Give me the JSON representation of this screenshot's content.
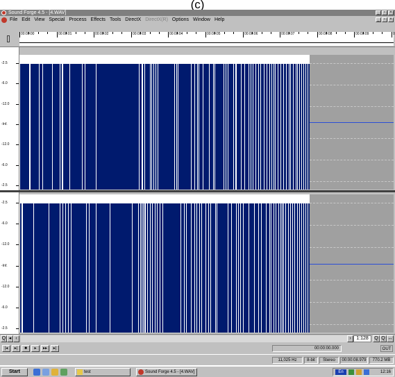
{
  "caption": "(c)",
  "window": {
    "title": "Sound Forge 4.5 - [4.WAV]"
  },
  "menu": [
    {
      "label": "File",
      "enabled": true
    },
    {
      "label": "Edit",
      "enabled": true
    },
    {
      "label": "View",
      "enabled": true
    },
    {
      "label": "Special",
      "enabled": true
    },
    {
      "label": "Process",
      "enabled": true
    },
    {
      "label": "Effects",
      "enabled": true
    },
    {
      "label": "Tools",
      "enabled": true
    },
    {
      "label": "DirectX",
      "enabled": true
    },
    {
      "label": "DirectX(R)",
      "enabled": false
    },
    {
      "label": "Options",
      "enabled": true
    },
    {
      "label": "Window",
      "enabled": true
    },
    {
      "label": "Help",
      "enabled": true
    }
  ],
  "ruler": {
    "labels": [
      "00:00:00",
      "00:00:01",
      "00:00:02",
      "00:00:03",
      "00:00:04",
      "00:00:05",
      "00:00:06",
      "00:00:07",
      "00:00:08",
      "00:00:09",
      "00:00:10"
    ]
  },
  "scale_labels": {
    "left": [
      "-2.5",
      "-6.0",
      "-12.0",
      "-Inf.",
      "-12.0",
      "-6.0",
      "-2.5"
    ],
    "right": [
      "-2.5",
      "-6.0",
      "-12.0",
      "-Inf.",
      "-12.0",
      "-6.0",
      "-2.5"
    ]
  },
  "zoom": "1:128",
  "time_display": "00:00:00.000",
  "out_label": "OUT",
  "status": {
    "sample_rate": "11,025 Hz",
    "bit_depth": "8-bit",
    "channels": "Stereo",
    "length": "00:00:08.979",
    "free_space": "770.2 MB"
  },
  "taskbar": {
    "start": "Start",
    "tasks": [
      {
        "label": "test"
      },
      {
        "label": "Sound Forge 4.5 - [4.WAV]"
      }
    ],
    "tray_lang": "En",
    "clock": "12:16"
  }
}
